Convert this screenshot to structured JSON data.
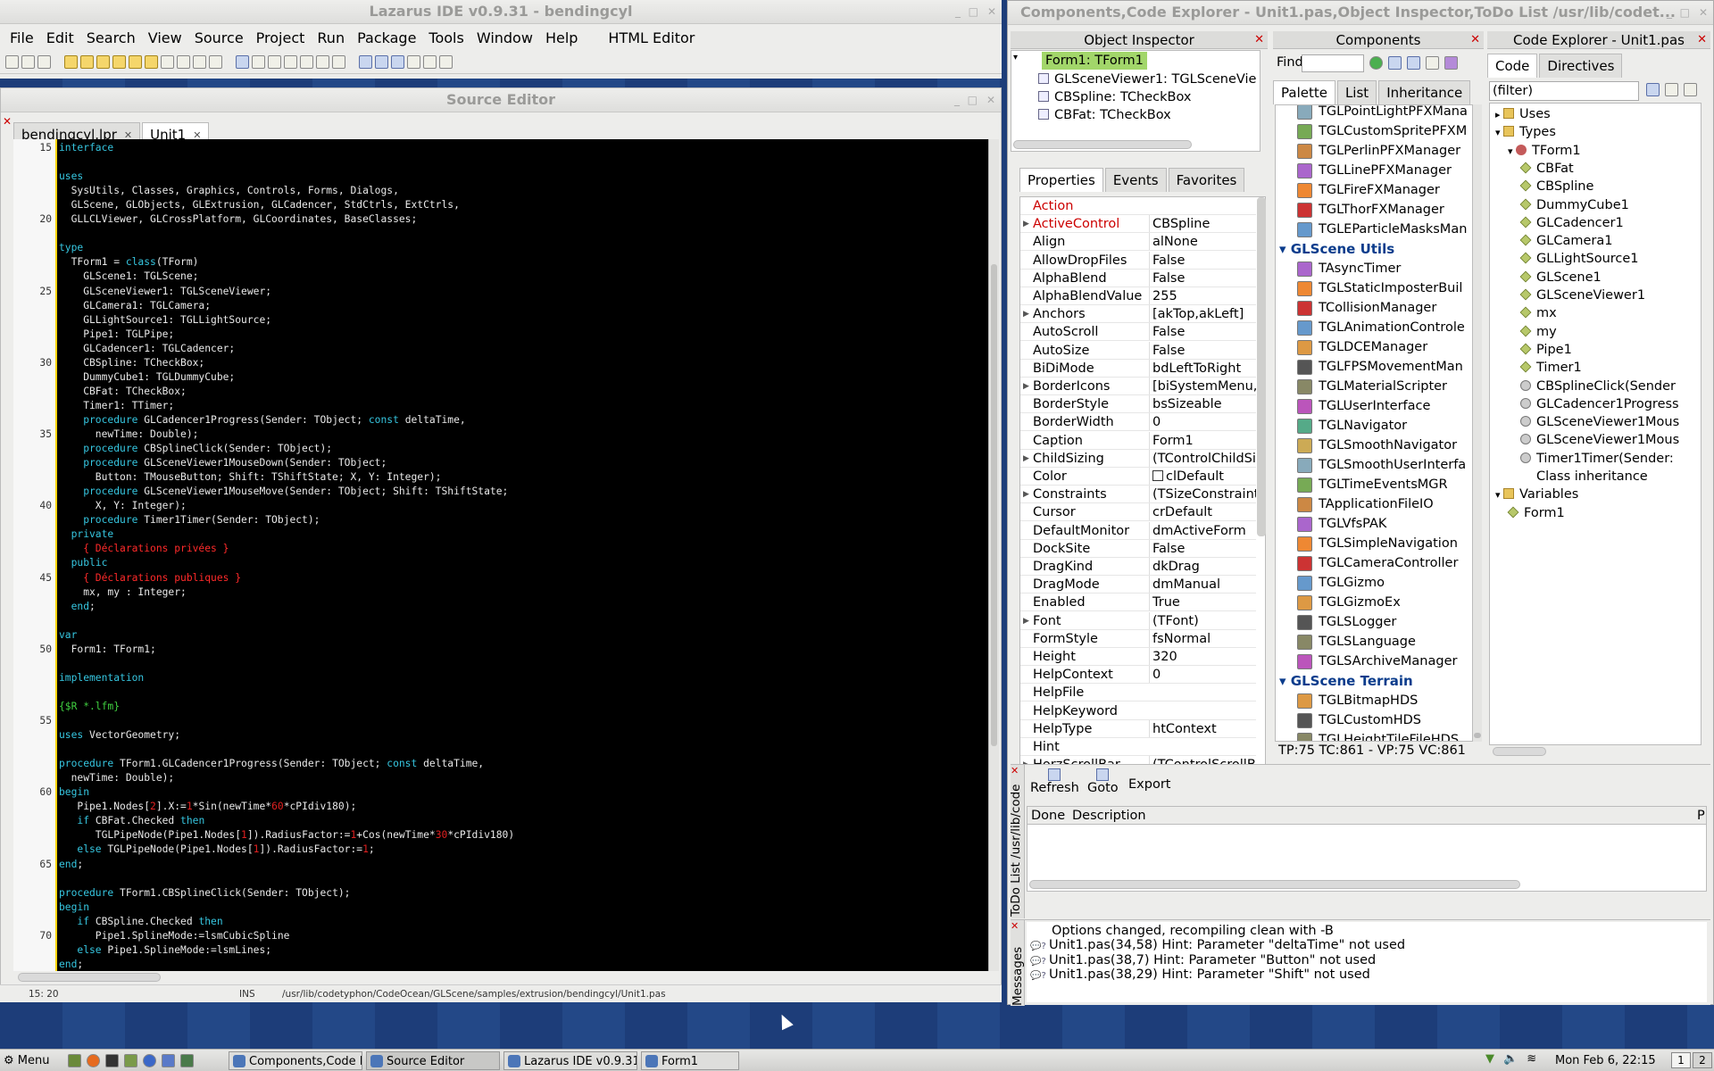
{
  "ide": {
    "title": "Lazarus IDE v0.9.31 - bendingcyl",
    "menu": [
      "File",
      "Edit",
      "Search",
      "View",
      "Source",
      "Project",
      "Run",
      "Package",
      "Tools",
      "Window",
      "Help",
      "HTML Editor"
    ]
  },
  "source_editor": {
    "title": "Source Editor",
    "tabs": [
      {
        "label": "bendingcyl.lpr"
      },
      {
        "label": "Unit1"
      }
    ],
    "status": {
      "position": "15: 20",
      "mode": "INS",
      "path": "/usr/lib/codetyphon/CodeOcean/GLScene/samples/extrusion/bendingcyl/Unit1.pas"
    },
    "line_numbers": [
      "15",
      "",
      "",
      "",
      "",
      "20",
      "",
      "",
      "",
      "",
      "25",
      "",
      "",
      "",
      "",
      "30",
      "",
      "",
      "",
      "",
      "35",
      "",
      "",
      "",
      "",
      "40",
      "",
      "",
      "",
      "",
      "45",
      "",
      "",
      "",
      "",
      "50",
      "",
      "",
      "",
      "",
      "55",
      "",
      "",
      "",
      "",
      "60",
      "",
      "",
      "",
      "",
      "65",
      "",
      "",
      "",
      "",
      "70",
      ""
    ],
    "lines": [
      [
        [
          "kw",
          "interface"
        ]
      ],
      [],
      [
        [
          "kw",
          "uses"
        ]
      ],
      [
        [
          "id",
          "  SysUtils, Classes, Graphics, Controls, Forms, Dialogs,"
        ]
      ],
      [
        [
          "id",
          "  GLScene, GLObjects, GLExtrusion, GLCadencer, StdCtrls, ExtCtrls,"
        ]
      ],
      [
        [
          "id",
          "  GLLCLViewer, GLCrossPlatform, GLCoordinates, BaseClasses;"
        ]
      ],
      [],
      [
        [
          "kw",
          "type"
        ]
      ],
      [
        [
          "id",
          "  TForm1 = "
        ],
        [
          "kw",
          "class"
        ],
        [
          "id",
          "(TForm)"
        ]
      ],
      [
        [
          "id",
          "    GLScene1: TGLScene;"
        ]
      ],
      [
        [
          "id",
          "    GLSceneViewer1: TGLSceneViewer;"
        ]
      ],
      [
        [
          "id",
          "    GLCamera1: TGLCamera;"
        ]
      ],
      [
        [
          "id",
          "    GLLightSource1: TGLLightSource;"
        ]
      ],
      [
        [
          "id",
          "    Pipe1: TGLPipe;"
        ]
      ],
      [
        [
          "id",
          "    GLCadencer1: TGLCadencer;"
        ]
      ],
      [
        [
          "id",
          "    CBSpline: TCheckBox;"
        ]
      ],
      [
        [
          "id",
          "    DummyCube1: TGLDummyCube;"
        ]
      ],
      [
        [
          "id",
          "    CBFat: TCheckBox;"
        ]
      ],
      [
        [
          "id",
          "    Timer1: TTimer;"
        ]
      ],
      [
        [
          "kw",
          "    procedure"
        ],
        [
          "id",
          " GLCadencer1Progress(Sender: TObject; "
        ],
        [
          "kw",
          "const"
        ],
        [
          "id",
          " deltaTime,"
        ]
      ],
      [
        [
          "id",
          "      newTime: Double);"
        ]
      ],
      [
        [
          "kw",
          "    procedure"
        ],
        [
          "id",
          " CBSplineClick(Sender: TObject);"
        ]
      ],
      [
        [
          "kw",
          "    procedure"
        ],
        [
          "id",
          " GLSceneViewer1MouseDown(Sender: TObject;"
        ]
      ],
      [
        [
          "id",
          "      Button: TMouseButton; Shift: TShiftState; X, Y: Integer);"
        ]
      ],
      [
        [
          "kw",
          "    procedure"
        ],
        [
          "id",
          " GLSceneViewer1MouseMove(Sender: TObject; Shift: TShiftState;"
        ]
      ],
      [
        [
          "id",
          "      X, Y: Integer);"
        ]
      ],
      [
        [
          "kw",
          "    procedure"
        ],
        [
          "id",
          " Timer1Timer(Sender: TObject);"
        ]
      ],
      [
        [
          "kw",
          "  private"
        ]
      ],
      [
        [
          "cm",
          "    { Déclarations privées }"
        ]
      ],
      [
        [
          "kw",
          "  public"
        ]
      ],
      [
        [
          "cm",
          "    { Déclarations publiques }"
        ]
      ],
      [
        [
          "id",
          "    mx, my : Integer;"
        ]
      ],
      [
        [
          "kw",
          "  end"
        ],
        [
          "id",
          ";"
        ]
      ],
      [],
      [
        [
          "kw",
          "var"
        ]
      ],
      [
        [
          "id",
          "  Form1: TForm1;"
        ]
      ],
      [],
      [
        [
          "kw",
          "implementation"
        ]
      ],
      [],
      [
        [
          "dir",
          "{$R *.lfm}"
        ]
      ],
      [],
      [
        [
          "kw",
          "uses"
        ],
        [
          "id",
          " VectorGeometry;"
        ]
      ],
      [],
      [
        [
          "kw",
          "procedure"
        ],
        [
          "id",
          " TForm1.GLCadencer1Progress(Sender: TObject; "
        ],
        [
          "kw",
          "const"
        ],
        [
          "id",
          " deltaTime,"
        ]
      ],
      [
        [
          "id",
          "  newTime: Double);"
        ]
      ],
      [
        [
          "kw",
          "begin"
        ]
      ],
      [
        [
          "id",
          "   Pipe1.Nodes["
        ],
        [
          "nm",
          "2"
        ],
        [
          "id",
          "].X:="
        ],
        [
          "nm",
          "1"
        ],
        [
          "id",
          "*Sin(newTime*"
        ],
        [
          "nm",
          "60"
        ],
        [
          "id",
          "*cPIdiv180);"
        ]
      ],
      [
        [
          "kw",
          "   if"
        ],
        [
          "id",
          " CBFat.Checked "
        ],
        [
          "kw",
          "then"
        ]
      ],
      [
        [
          "id",
          "      TGLPipeNode(Pipe1.Nodes["
        ],
        [
          "nm",
          "1"
        ],
        [
          "id",
          "]).RadiusFactor:="
        ],
        [
          "nm",
          "1"
        ],
        [
          "id",
          "+Cos(newTime*"
        ],
        [
          "nm",
          "30"
        ],
        [
          "id",
          "*cPIdiv180)"
        ]
      ],
      [
        [
          "kw",
          "   else"
        ],
        [
          "id",
          " TGLPipeNode(Pipe1.Nodes["
        ],
        [
          "nm",
          "1"
        ],
        [
          "id",
          "]).RadiusFactor:="
        ],
        [
          "nm",
          "1"
        ],
        [
          "id",
          ";"
        ]
      ],
      [
        [
          "kw",
          "end"
        ],
        [
          "id",
          ";"
        ]
      ],
      [],
      [
        [
          "kw",
          "procedure"
        ],
        [
          "id",
          " TForm1.CBSplineClick(Sender: TObject);"
        ]
      ],
      [
        [
          "kw",
          "begin"
        ]
      ],
      [
        [
          "kw",
          "   if"
        ],
        [
          "id",
          " CBSpline.Checked "
        ],
        [
          "kw",
          "then"
        ]
      ],
      [
        [
          "id",
          "      Pipe1.SplineMode:=lsmCubicSpline"
        ]
      ],
      [
        [
          "kw",
          "   else"
        ],
        [
          "id",
          " Pipe1.SplineMode:=lsmLines;"
        ]
      ],
      [
        [
          "kw",
          "end"
        ],
        [
          "id",
          ";"
        ]
      ]
    ]
  },
  "right_window_title": "Components,Code Explorer - Unit1.pas,Object Inspector,ToDo List /usr/lib/codet...",
  "object_inspector": {
    "title": "Object Inspector",
    "tree": [
      "Form1: TForm1",
      "GLSceneViewer1: TGLSceneVie",
      "CBSpline: TCheckBox",
      "CBFat: TCheckBox"
    ],
    "tabs": [
      "Properties",
      "Events",
      "Favorites"
    ],
    "props": [
      [
        "Action",
        "",
        false
      ],
      [
        "ActiveControl",
        "CBSpline",
        true
      ],
      [
        "Align",
        "alNone",
        false
      ],
      [
        "AllowDropFiles",
        "False",
        false
      ],
      [
        "AlphaBlend",
        "False",
        false
      ],
      [
        "AlphaBlendValue",
        "255",
        false
      ],
      [
        "Anchors",
        "[akTop,akLeft]",
        true
      ],
      [
        "AutoScroll",
        "False",
        false
      ],
      [
        "AutoSize",
        "False",
        false
      ],
      [
        "BiDiMode",
        "bdLeftToRight",
        false
      ],
      [
        "BorderIcons",
        "[biSystemMenu,b",
        true
      ],
      [
        "BorderStyle",
        "bsSizeable",
        false
      ],
      [
        "BorderWidth",
        "0",
        false
      ],
      [
        "Caption",
        "Form1",
        false
      ],
      [
        "ChildSizing",
        "(TControlChildSizi",
        true
      ],
      [
        "Color",
        "clDefault",
        false
      ],
      [
        "Constraints",
        "(TSizeConstraints",
        true
      ],
      [
        "Cursor",
        "crDefault",
        false
      ],
      [
        "DefaultMonitor",
        "dmActiveForm",
        false
      ],
      [
        "DockSite",
        "False",
        false
      ],
      [
        "DragKind",
        "dkDrag",
        false
      ],
      [
        "DragMode",
        "dmManual",
        false
      ],
      [
        "Enabled",
        "True",
        false
      ],
      [
        "Font",
        "(TFont)",
        true
      ],
      [
        "FormStyle",
        "fsNormal",
        false
      ],
      [
        "Height",
        "320",
        false
      ],
      [
        "HelpContext",
        "0",
        false
      ],
      [
        "HelpFile",
        "",
        false
      ],
      [
        "HelpKeyword",
        "",
        false
      ],
      [
        "HelpType",
        "htContext",
        false
      ],
      [
        "Hint",
        "",
        false
      ],
      [
        "HorzScrollBar",
        "(TControlScrollBa",
        true
      ]
    ]
  },
  "components": {
    "title": "Components",
    "find_label": "Find",
    "tabs": [
      "Palette",
      "List",
      "Inheritance"
    ],
    "items_top": [
      "TGLPointLightPFXMana",
      "TGLCustomSpritePFXM",
      "TGLPerlinPFXManager",
      "TGLLinePFXManager",
      "TGLFireFXManager",
      "TGLThorFXManager",
      "TGLEParticleMasksMan"
    ],
    "section1": "GLScene Utils",
    "items_utils": [
      "TAsyncTimer",
      "TGLStaticImposterBuil",
      "TCollisionManager",
      "TGLAnimationControle",
      "TGLDCEManager",
      "TGLFPSMovementMan",
      "TGLMaterialScripter",
      "TGLUserInterface",
      "TGLNavigator",
      "TGLSmoothNavigator",
      "TGLSmoothUserInterfa",
      "TGLTimeEventsMGR",
      "TApplicationFileIO",
      "TGLVfsPAK",
      "TGLSimpleNavigation",
      "TGLCameraController",
      "TGLGizmo",
      "TGLGizmoEx",
      "TGLSLogger",
      "TGLSLanguage",
      "TGLSArchiveManager"
    ],
    "section2": "GLScene Terrain",
    "items_terrain": [
      "TGLBitmapHDS",
      "TGLCustomHDS",
      "TGLHeightTileFileHDS"
    ],
    "status": "TP:75 TC:861 - VP:75 VC:861"
  },
  "code_explorer": {
    "title": "Code Explorer - Unit1.pas",
    "tabs": [
      "Code",
      "Directives"
    ],
    "filter": "(filter)",
    "nodes": [
      [
        "Uses",
        0,
        "folder"
      ],
      [
        "Types",
        0,
        "folder"
      ],
      [
        "TForm1",
        1,
        "class"
      ],
      [
        "CBFat",
        2,
        "field"
      ],
      [
        "CBSpline",
        2,
        "field"
      ],
      [
        "DummyCube1",
        2,
        "field"
      ],
      [
        "GLCadencer1",
        2,
        "field"
      ],
      [
        "GLCamera1",
        2,
        "field"
      ],
      [
        "GLLightSource1",
        2,
        "field"
      ],
      [
        "GLScene1",
        2,
        "field"
      ],
      [
        "GLSceneViewer1",
        2,
        "field"
      ],
      [
        "mx",
        2,
        "field"
      ],
      [
        "my",
        2,
        "field"
      ],
      [
        "Pipe1",
        2,
        "field"
      ],
      [
        "Timer1",
        2,
        "field"
      ],
      [
        "CBSplineClick(Sender",
        2,
        "method"
      ],
      [
        "GLCadencer1Progress",
        2,
        "method"
      ],
      [
        "GLSceneViewer1Mous",
        2,
        "method"
      ],
      [
        "GLSceneViewer1Mous",
        2,
        "method"
      ],
      [
        "Timer1Timer(Sender:",
        2,
        "method"
      ],
      [
        "Class inheritance",
        2,
        "none"
      ],
      [
        "Variables",
        0,
        "folder"
      ],
      [
        "Form1",
        1,
        "field"
      ]
    ]
  },
  "todo": {
    "side_label": "ToDo List /usr/lib/code",
    "buttons": [
      "Refresh",
      "Goto",
      "Export"
    ],
    "columns": [
      "Done",
      "Description",
      "P"
    ]
  },
  "messages": {
    "side_label": "Messages",
    "items": [
      "Options changed, recompiling clean with -B",
      "Unit1.pas(34,58) Hint: Parameter \"deltaTime\" not used",
      "Unit1.pas(38,7) Hint: Parameter \"Button\" not used",
      "Unit1.pas(38,29) Hint: Parameter \"Shift\" not used"
    ]
  },
  "taskbar": {
    "menu_label": "Menu",
    "tasks": [
      "Components,Code E...",
      "Source Editor",
      "Lazarus IDE v0.9.31 ...",
      "Form1"
    ],
    "clock": "Mon Feb  6, 22:15",
    "workspaces": [
      "1",
      "2"
    ]
  }
}
